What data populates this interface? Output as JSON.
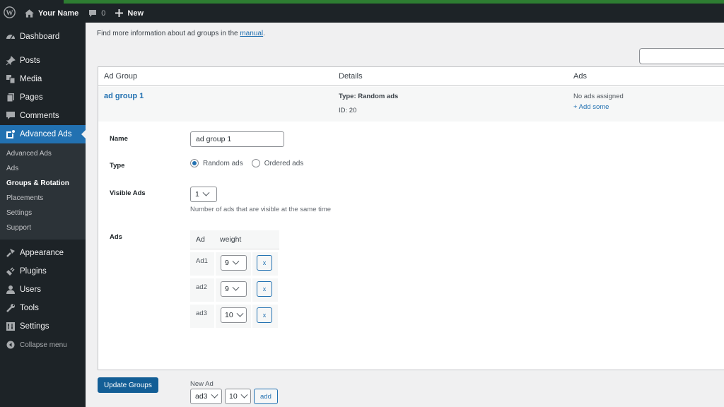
{
  "adminbar": {
    "site_name": "Your Name",
    "comments_count": "0",
    "new_label": "New"
  },
  "sidebar": {
    "items": [
      {
        "label": "Dashboard",
        "icon": "dashboard-icon"
      },
      {
        "label": "Posts",
        "icon": "pin-icon"
      },
      {
        "label": "Media",
        "icon": "media-icon"
      },
      {
        "label": "Pages",
        "icon": "pages-icon"
      },
      {
        "label": "Comments",
        "icon": "comment-icon"
      },
      {
        "label": "Advanced Ads",
        "icon": "advanced-ads-icon",
        "active": true
      }
    ],
    "submenu": [
      {
        "label": "Advanced Ads"
      },
      {
        "label": "Ads"
      },
      {
        "label": "Groups & Rotation",
        "current": true
      },
      {
        "label": "Placements"
      },
      {
        "label": "Settings"
      },
      {
        "label": "Support"
      }
    ],
    "items_bottom": [
      {
        "label": "Appearance",
        "icon": "brush-icon"
      },
      {
        "label": "Plugins",
        "icon": "plugin-icon"
      },
      {
        "label": "Users",
        "icon": "user-icon"
      },
      {
        "label": "Tools",
        "icon": "wrench-icon"
      },
      {
        "label": "Settings",
        "icon": "settings-icon"
      }
    ],
    "collapse_label": "Collapse menu"
  },
  "main": {
    "info_prefix": "Find more information about ad groups in the ",
    "info_link": "manual",
    "info_suffix": ".",
    "search_value": "",
    "table": {
      "headers": [
        "Ad Group",
        "Details",
        "Ads"
      ],
      "group": {
        "name": "ad group 1",
        "type": "Type: Random ads",
        "id": "ID: 20",
        "ads_status": "No ads assigned",
        "add_link": "+ Add some"
      }
    },
    "form": {
      "name_label": "Name",
      "name_value": "ad group 1",
      "type_label": "Type",
      "type_options": [
        {
          "label": "Random ads",
          "checked": true
        },
        {
          "label": "Ordered ads",
          "checked": false
        }
      ],
      "visible_label": "Visible Ads",
      "visible_value": "1",
      "visible_hint": "Number of ads that are visible at the same time",
      "ads_label": "Ads",
      "ads_headers": [
        "Ad",
        "weight"
      ],
      "ads": [
        {
          "name": "Ad1",
          "weight": "9",
          "remove": "x"
        },
        {
          "name": "ad2",
          "weight": "9",
          "remove": "x"
        },
        {
          "name": "ad3",
          "weight": "10",
          "remove": "x"
        }
      ],
      "new_ad_label": "New Ad",
      "new_ad_select": "ad3",
      "new_ad_weight": "10",
      "add_label": "add"
    },
    "update_label": "Update Groups"
  }
}
